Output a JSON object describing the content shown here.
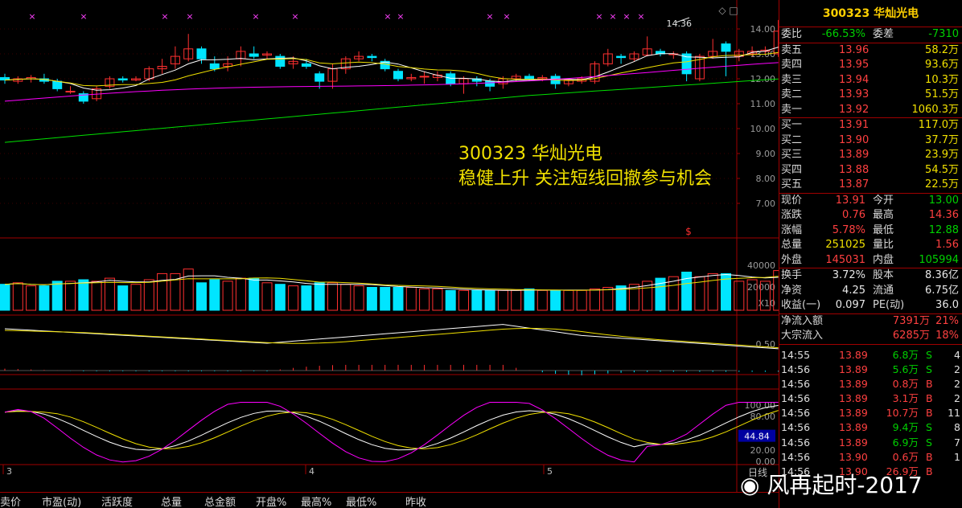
{
  "stock": {
    "code_name": "300323 华灿光电"
  },
  "overlay": {
    "line1": "300323 华灿光电",
    "line2": "稳健上升 关注短线回撤参与机会"
  },
  "price_axis": [
    "14.00",
    "13.00",
    "12.00",
    "11.00",
    "10.00",
    "9.00",
    "8.00",
    "7.00"
  ],
  "price_high_label": "14.36",
  "volume_axis": [
    "40000",
    "20000",
    "X10"
  ],
  "macd_axis": [
    "0.50"
  ],
  "kdj_axis": [
    "100.00",
    "80.00",
    "44.84",
    "20.00",
    "0.00"
  ],
  "date_marks": [
    "3",
    "4",
    "5"
  ],
  "side_date_hint": "日线",
  "weibi": {
    "label": "委比",
    "value": "-66.53%",
    "label2": "委差",
    "value2": "-7310"
  },
  "sells": [
    {
      "label": "卖五",
      "price": "13.96",
      "vol": "58.2万"
    },
    {
      "label": "卖四",
      "price": "13.95",
      "vol": "93.6万"
    },
    {
      "label": "卖三",
      "price": "13.94",
      "vol": "10.3万"
    },
    {
      "label": "卖二",
      "price": "13.93",
      "vol": "51.5万"
    },
    {
      "label": "卖一",
      "price": "13.92",
      "vol": "1060.3万"
    }
  ],
  "buys": [
    {
      "label": "买一",
      "price": "13.91",
      "vol": "117.0万"
    },
    {
      "label": "买二",
      "price": "13.90",
      "vol": "37.7万"
    },
    {
      "label": "买三",
      "price": "13.89",
      "vol": "23.9万"
    },
    {
      "label": "买四",
      "price": "13.88",
      "vol": "54.5万"
    },
    {
      "label": "买五",
      "price": "13.87",
      "vol": "22.5万"
    }
  ],
  "quote": [
    {
      "l1": "现价",
      "v1": "13.91",
      "c1": "red",
      "l2": "今开",
      "v2": "13.00",
      "c2": "green"
    },
    {
      "l1": "涨跌",
      "v1": "0.76",
      "c1": "red",
      "l2": "最高",
      "v2": "14.36",
      "c2": "red"
    },
    {
      "l1": "涨幅",
      "v1": "5.78%",
      "c1": "red",
      "l2": "最低",
      "v2": "12.88",
      "c2": "green"
    },
    {
      "l1": "总量",
      "v1": "251025",
      "c1": "yellow",
      "l2": "量比",
      "v2": "1.56",
      "c2": "red"
    },
    {
      "l1": "外盘",
      "v1": "145031",
      "c1": "red",
      "l2": "内盘",
      "v2": "105994",
      "c2": "green"
    }
  ],
  "fundamentals": [
    {
      "l1": "换手",
      "v1": "3.72%",
      "l2": "股本",
      "v2": "8.36亿"
    },
    {
      "l1": "净资",
      "v1": "4.25",
      "l2": "流通",
      "v2": "6.75亿"
    },
    {
      "l1": "收益(一)",
      "v1": "0.097",
      "l2": "PE(动)",
      "v2": "36.0"
    }
  ],
  "flows": [
    {
      "label": "净流入额",
      "value": "7391万",
      "pct": "21%"
    },
    {
      "label": "大宗流入",
      "value": "6285万",
      "pct": "18%"
    }
  ],
  "ticks": [
    {
      "time": "14:55",
      "price": "13.89",
      "vol": "6.8万",
      "dir": "S",
      "cnt": "4"
    },
    {
      "time": "14:56",
      "price": "13.89",
      "vol": "5.6万",
      "dir": "S",
      "cnt": "2"
    },
    {
      "time": "14:56",
      "price": "13.89",
      "vol": "0.8万",
      "dir": "B",
      "cnt": "2"
    },
    {
      "time": "14:56",
      "price": "13.89",
      "vol": "3.1万",
      "dir": "B",
      "cnt": "2"
    },
    {
      "time": "14:56",
      "price": "13.89",
      "vol": "10.7万",
      "dir": "B",
      "cnt": "11"
    },
    {
      "time": "14:56",
      "price": "13.89",
      "vol": "9.4万",
      "dir": "S",
      "cnt": "8"
    },
    {
      "time": "14:56",
      "price": "13.89",
      "vol": "6.9万",
      "dir": "S",
      "cnt": "7"
    },
    {
      "time": "14:56",
      "price": "13.90",
      "vol": "0.6万",
      "dir": "B",
      "cnt": "1"
    },
    {
      "time": "14:56",
      "price": "13.90",
      "vol": "26.9万",
      "dir": "B",
      "cnt": ""
    }
  ],
  "bottom_tabs": [
    "卖价",
    "市盈(动)",
    "活跃度",
    "总量",
    "总金额",
    "开盘%",
    "最高%",
    "最低%",
    "昨收"
  ],
  "watermark": "风再起时-2017",
  "colors": {
    "up": "#ff3030",
    "down": "#00e5ff",
    "ma5": "#ffffff",
    "ma10": "#f0e000",
    "ma20": "#ff00ff",
    "ma60": "#00e000",
    "border": "#a00000"
  },
  "chart_data": {
    "type": "candlestick",
    "ylim": [
      6.5,
      14.5
    ],
    "candles": [
      {
        "o": 12.05,
        "c": 11.95,
        "h": 12.2,
        "l": 11.8
      },
      {
        "o": 11.9,
        "c": 12.0,
        "h": 12.1,
        "l": 11.8
      },
      {
        "o": 12.0,
        "c": 12.05,
        "h": 12.15,
        "l": 11.85
      },
      {
        "o": 12.0,
        "c": 11.9,
        "h": 12.2,
        "l": 11.8
      },
      {
        "o": 11.9,
        "c": 11.6,
        "h": 12.0,
        "l": 11.5
      },
      {
        "o": 11.5,
        "c": 11.5,
        "h": 11.7,
        "l": 11.4
      },
      {
        "o": 11.4,
        "c": 11.1,
        "h": 11.5,
        "l": 11.0
      },
      {
        "o": 11.2,
        "c": 11.6,
        "h": 11.7,
        "l": 11.1
      },
      {
        "o": 11.7,
        "c": 12.0,
        "h": 12.1,
        "l": 11.6
      },
      {
        "o": 12.0,
        "c": 11.95,
        "h": 12.1,
        "l": 11.85
      },
      {
        "o": 11.95,
        "c": 12.0,
        "h": 12.1,
        "l": 11.9
      },
      {
        "o": 12.0,
        "c": 12.4,
        "h": 12.5,
        "l": 11.9
      },
      {
        "o": 12.4,
        "c": 12.5,
        "h": 12.8,
        "l": 12.2
      },
      {
        "o": 12.6,
        "c": 12.9,
        "h": 13.3,
        "l": 12.4
      },
      {
        "o": 12.8,
        "c": 13.2,
        "h": 13.8,
        "l": 12.7
      },
      {
        "o": 13.2,
        "c": 12.8,
        "h": 13.3,
        "l": 12.6
      },
      {
        "o": 12.6,
        "c": 12.4,
        "h": 12.9,
        "l": 12.3
      },
      {
        "o": 12.5,
        "c": 12.6,
        "h": 12.9,
        "l": 12.3
      },
      {
        "o": 12.8,
        "c": 13.1,
        "h": 13.3,
        "l": 12.5
      },
      {
        "o": 13.0,
        "c": 12.9,
        "h": 13.3,
        "l": 12.8
      },
      {
        "o": 12.95,
        "c": 13.0,
        "h": 13.1,
        "l": 12.8
      },
      {
        "o": 12.9,
        "c": 12.5,
        "h": 13.0,
        "l": 12.4
      },
      {
        "o": 12.6,
        "c": 12.7,
        "h": 12.9,
        "l": 12.4
      },
      {
        "o": 12.6,
        "c": 12.5,
        "h": 12.8,
        "l": 12.4
      },
      {
        "o": 12.2,
        "c": 11.9,
        "h": 12.3,
        "l": 11.6
      },
      {
        "o": 11.9,
        "c": 12.4,
        "h": 12.6,
        "l": 11.6
      },
      {
        "o": 12.4,
        "c": 12.8,
        "h": 12.9,
        "l": 12.2
      },
      {
        "o": 12.8,
        "c": 12.9,
        "h": 13.1,
        "l": 12.7
      },
      {
        "o": 12.9,
        "c": 12.85,
        "h": 13.0,
        "l": 12.7
      },
      {
        "o": 12.7,
        "c": 12.4,
        "h": 12.8,
        "l": 12.3
      },
      {
        "o": 12.3,
        "c": 12.0,
        "h": 12.4,
        "l": 11.9
      },
      {
        "o": 12.0,
        "c": 12.05,
        "h": 12.2,
        "l": 11.9
      },
      {
        "o": 12.1,
        "c": 12.1,
        "h": 12.3,
        "l": 11.8
      },
      {
        "o": 12.05,
        "c": 12.15,
        "h": 12.3,
        "l": 11.9
      },
      {
        "o": 12.2,
        "c": 11.8,
        "h": 12.3,
        "l": 11.7
      },
      {
        "o": 11.8,
        "c": 12.0,
        "h": 12.1,
        "l": 11.4
      },
      {
        "o": 12.0,
        "c": 11.9,
        "h": 12.1,
        "l": 11.7
      },
      {
        "o": 11.9,
        "c": 11.7,
        "h": 12.0,
        "l": 11.5
      },
      {
        "o": 11.8,
        "c": 12.0,
        "h": 12.1,
        "l": 11.6
      },
      {
        "o": 12.0,
        "c": 12.1,
        "h": 12.2,
        "l": 11.9
      },
      {
        "o": 12.1,
        "c": 12.0,
        "h": 12.2,
        "l": 11.9
      },
      {
        "o": 12.0,
        "c": 12.05,
        "h": 12.15,
        "l": 11.9
      },
      {
        "o": 12.1,
        "c": 11.8,
        "h": 12.2,
        "l": 11.6
      },
      {
        "o": 11.8,
        "c": 11.95,
        "h": 12.0,
        "l": 11.7
      },
      {
        "o": 11.9,
        "c": 12.0,
        "h": 12.1,
        "l": 11.8
      },
      {
        "o": 11.9,
        "c": 12.6,
        "h": 12.7,
        "l": 11.8
      },
      {
        "o": 12.6,
        "c": 13.0,
        "h": 13.2,
        "l": 12.5
      },
      {
        "o": 12.9,
        "c": 12.85,
        "h": 13.0,
        "l": 12.6
      },
      {
        "o": 12.8,
        "c": 13.0,
        "h": 13.1,
        "l": 12.7
      },
      {
        "o": 12.95,
        "c": 13.2,
        "h": 13.7,
        "l": 12.9
      },
      {
        "o": 13.1,
        "c": 13.0,
        "h": 13.2,
        "l": 12.9
      },
      {
        "o": 13.0,
        "c": 13.0,
        "h": 13.1,
        "l": 12.8
      },
      {
        "o": 13.0,
        "c": 12.2,
        "h": 13.1,
        "l": 11.9
      },
      {
        "o": 12.0,
        "c": 12.9,
        "h": 13.0,
        "l": 11.9
      },
      {
        "o": 12.9,
        "c": 13.1,
        "h": 13.6,
        "l": 12.8
      },
      {
        "o": 13.4,
        "c": 13.1,
        "h": 13.5,
        "l": 12.1
      },
      {
        "o": 12.9,
        "c": 13.1,
        "h": 13.2,
        "l": 12.7
      },
      {
        "o": 13.0,
        "c": 13.1,
        "h": 13.3,
        "l": 12.9
      },
      {
        "o": 13.1,
        "c": 13.15,
        "h": 13.3,
        "l": 13.0
      },
      {
        "o": 13.0,
        "c": 13.91,
        "h": 14.36,
        "l": 12.88
      }
    ],
    "volume": [
      17,
      18,
      16,
      16,
      19,
      19,
      20,
      19,
      21,
      16,
      17,
      20,
      24,
      24,
      27,
      18,
      20,
      19,
      21,
      21,
      18,
      17,
      16,
      16,
      18,
      18,
      17,
      16,
      15,
      15,
      15,
      15,
      14,
      14,
      13,
      13,
      13,
      13,
      13,
      13,
      14,
      13,
      13,
      13,
      13,
      14,
      15,
      16,
      17,
      19,
      21,
      22,
      25,
      22,
      24,
      24,
      19,
      20,
      19,
      26
    ]
  }
}
